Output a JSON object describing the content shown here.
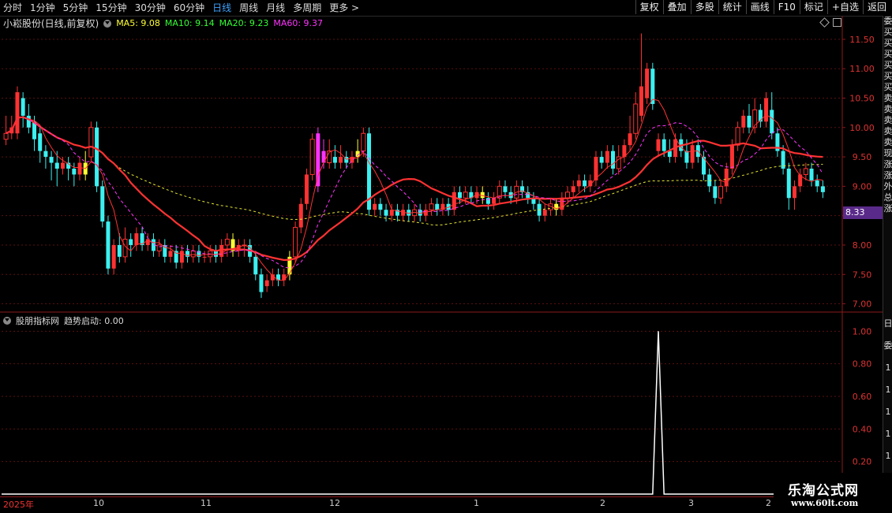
{
  "toolbar": {
    "periods": [
      "分时",
      "1分钟",
      "5分钟",
      "15分钟",
      "30分钟",
      "60分钟",
      "日线",
      "周线",
      "月线",
      "多周期",
      "更多 >"
    ],
    "active_period": "日线",
    "actions": [
      "复权",
      "叠加",
      "多股",
      "统计",
      "画线",
      "F10",
      "标记",
      "+自选",
      "返回"
    ]
  },
  "main": {
    "stock_title": "小崧股份(日线,前复权)",
    "ma": [
      {
        "label": "MA5: 9.08",
        "color": "#ffff33"
      },
      {
        "label": "MA10: 9.14",
        "color": "#33ff33"
      },
      {
        "label": "MA20: 9.23",
        "color": "#33ff33"
      },
      {
        "label": "MA60: 9.37",
        "color": "#ff33ff"
      }
    ],
    "price_axis": [
      "11.50",
      "11.00",
      "10.50",
      "10.00",
      "9.50",
      "9.00",
      "8.50",
      "8.00",
      "7.50",
      "7.00"
    ],
    "current_price": "8.33"
  },
  "indicator": {
    "title": "股朋指标网",
    "value_label": "趋势启动: 0.00",
    "axis": [
      "1.00",
      "0.80",
      "0.60",
      "0.40",
      "0.20"
    ]
  },
  "right_strip_chars": "委买买买买买买卖卖卖卖卖现涨涨外总涨",
  "right_strip_chars2": "日委11111",
  "date_axis": [
    "2025年",
    "10",
    "11",
    "12",
    "1",
    "2",
    "3",
    "2"
  ],
  "logo": {
    "line1": "乐淘公式网",
    "line2": "www.60lt.com"
  },
  "colors": {
    "up": "#ff3232",
    "down": "#3cf0f0",
    "limit_up": "#ff33ff",
    "yellow": "#ffff33"
  },
  "chart_data": {
    "type": "candlestick",
    "ylim": [
      6.9,
      11.7
    ],
    "price_ticks": [
      11.5,
      11.0,
      10.5,
      10.0,
      9.5,
      9.0,
      8.5,
      8.0,
      7.5,
      7.0
    ],
    "indicator_ylim": [
      0,
      1.05
    ],
    "indicator_ticks": [
      1.0,
      0.8,
      0.6,
      0.4,
      0.2
    ],
    "indicator_spike_index": 115,
    "candles": [
      [
        9.8,
        9.9,
        10.2,
        9.7
      ],
      [
        9.9,
        10.0,
        10.2,
        9.8
      ],
      [
        9.9,
        10.6,
        10.7,
        9.8
      ],
      [
        10.5,
        10.2,
        10.6,
        10.0
      ],
      [
        10.2,
        10.0,
        10.4,
        9.9
      ],
      [
        10.1,
        9.8,
        10.2,
        9.6
      ],
      [
        9.9,
        9.6,
        10.0,
        9.4
      ],
      [
        9.6,
        9.5,
        9.7,
        9.3
      ],
      [
        9.5,
        9.4,
        9.6,
        9.1
      ],
      [
        9.4,
        9.3,
        9.6,
        9.0
      ],
      [
        9.3,
        9.4,
        9.5,
        9.2
      ],
      [
        9.4,
        9.3,
        9.5,
        9.1
      ],
      [
        9.3,
        9.2,
        9.4,
        9.0
      ],
      [
        9.2,
        9.4,
        9.5,
        9.1
      ],
      [
        9.4,
        9.2,
        9.6,
        9.1
      ],
      [
        9.5,
        10.0,
        10.1,
        9.4
      ],
      [
        10.0,
        9.0,
        10.1,
        8.9
      ],
      [
        9.0,
        8.4,
        9.1,
        8.3
      ],
      [
        8.4,
        7.6,
        8.5,
        7.5
      ],
      [
        7.6,
        8.0,
        8.1,
        7.5
      ],
      [
        8.0,
        7.8,
        8.2,
        7.7
      ],
      [
        7.8,
        8.1,
        8.3,
        7.7
      ],
      [
        8.1,
        8.0,
        8.2,
        7.8
      ],
      [
        8.0,
        8.2,
        8.3,
        7.9
      ],
      [
        8.2,
        8.0,
        8.3,
        7.9
      ],
      [
        8.0,
        8.1,
        8.2,
        7.9
      ],
      [
        8.1,
        7.9,
        8.2,
        7.8
      ],
      [
        7.9,
        8.0,
        8.1,
        7.8
      ],
      [
        8.0,
        7.8,
        8.1,
        7.7
      ],
      [
        7.8,
        7.9,
        8.0,
        7.7
      ],
      [
        7.9,
        7.7,
        8.0,
        7.6
      ],
      [
        7.7,
        7.9,
        8.0,
        7.6
      ],
      [
        7.9,
        7.8,
        8.0,
        7.7
      ],
      [
        7.8,
        7.9,
        8.0,
        7.7
      ],
      [
        7.9,
        7.8,
        8.0,
        7.7
      ],
      [
        7.8,
        7.8,
        7.9,
        7.7
      ],
      [
        7.8,
        7.9,
        8.0,
        7.7
      ],
      [
        7.9,
        7.8,
        8.0,
        7.7
      ],
      [
        7.8,
        8.0,
        8.1,
        7.7
      ],
      [
        8.0,
        8.1,
        8.2,
        7.8
      ],
      [
        8.1,
        7.9,
        8.2,
        7.8
      ],
      [
        7.9,
        8.0,
        8.1,
        7.8
      ],
      [
        8.0,
        8.0,
        8.1,
        7.8
      ],
      [
        8.0,
        7.8,
        8.1,
        7.7
      ],
      [
        7.8,
        7.5,
        7.9,
        7.4
      ],
      [
        7.5,
        7.2,
        7.6,
        7.1
      ],
      [
        7.3,
        7.4,
        7.5,
        7.2
      ],
      [
        7.4,
        7.5,
        7.6,
        7.3
      ],
      [
        7.5,
        7.4,
        7.6,
        7.3
      ],
      [
        7.4,
        7.5,
        7.6,
        7.3
      ],
      [
        7.5,
        7.8,
        7.9,
        7.4
      ],
      [
        7.8,
        8.3,
        8.4,
        7.7
      ],
      [
        8.3,
        8.7,
        8.8,
        8.2
      ],
      [
        8.7,
        9.2,
        9.3,
        8.6
      ],
      [
        9.2,
        9.8,
        9.9,
        9.1
      ],
      [
        9.0,
        9.9,
        10.0,
        8.9
      ],
      [
        9.6,
        9.4,
        9.8,
        9.3
      ],
      [
        9.4,
        9.6,
        9.8,
        9.3
      ],
      [
        9.5,
        9.4,
        9.7,
        9.3
      ],
      [
        9.4,
        9.5,
        9.7,
        9.3
      ],
      [
        9.5,
        9.4,
        9.6,
        9.3
      ],
      [
        9.4,
        9.5,
        9.6,
        9.3
      ],
      [
        9.5,
        9.6,
        9.8,
        9.4
      ],
      [
        9.6,
        9.9,
        10.0,
        9.5
      ],
      [
        9.9,
        8.6,
        10.0,
        8.5
      ],
      [
        8.6,
        8.7,
        8.8,
        8.5
      ],
      [
        8.7,
        8.6,
        8.8,
        8.5
      ],
      [
        8.6,
        8.5,
        8.7,
        8.4
      ],
      [
        8.5,
        8.6,
        8.7,
        8.4
      ],
      [
        8.6,
        8.5,
        8.7,
        8.4
      ],
      [
        8.5,
        8.6,
        8.7,
        8.4
      ],
      [
        8.6,
        8.5,
        8.7,
        8.4
      ],
      [
        8.5,
        8.6,
        8.7,
        8.4
      ],
      [
        8.6,
        8.5,
        8.7,
        8.4
      ],
      [
        8.5,
        8.6,
        8.7,
        8.4
      ],
      [
        8.6,
        8.7,
        8.8,
        8.5
      ],
      [
        8.7,
        8.6,
        8.8,
        8.5
      ],
      [
        8.6,
        8.7,
        8.8,
        8.5
      ],
      [
        8.7,
        8.6,
        8.8,
        8.5
      ],
      [
        8.6,
        8.9,
        9.0,
        8.5
      ],
      [
        8.9,
        8.8,
        9.0,
        8.7
      ],
      [
        8.8,
        8.9,
        9.0,
        8.7
      ],
      [
        8.9,
        8.8,
        9.0,
        8.7
      ],
      [
        8.8,
        8.9,
        9.0,
        8.7
      ],
      [
        8.9,
        8.8,
        9.0,
        8.7
      ],
      [
        8.8,
        8.7,
        8.9,
        8.6
      ],
      [
        8.7,
        8.8,
        8.9,
        8.6
      ],
      [
        8.8,
        9.0,
        9.1,
        8.7
      ],
      [
        9.0,
        8.9,
        9.1,
        8.8
      ],
      [
        8.9,
        8.8,
        9.0,
        8.7
      ],
      [
        8.8,
        9.0,
        9.1,
        8.7
      ],
      [
        9.0,
        8.9,
        9.1,
        8.8
      ],
      [
        8.9,
        8.8,
        9.0,
        8.7
      ],
      [
        8.8,
        8.7,
        8.9,
        8.6
      ],
      [
        8.7,
        8.5,
        8.8,
        8.4
      ],
      [
        8.5,
        8.6,
        8.7,
        8.4
      ],
      [
        8.6,
        8.7,
        8.8,
        8.5
      ],
      [
        8.7,
        8.6,
        8.8,
        8.5
      ],
      [
        8.6,
        8.8,
        8.9,
        8.5
      ],
      [
        8.8,
        8.9,
        9.0,
        8.7
      ],
      [
        8.9,
        9.0,
        9.1,
        8.8
      ],
      [
        9.0,
        9.1,
        9.2,
        8.9
      ],
      [
        9.1,
        9.0,
        9.2,
        8.9
      ],
      [
        9.0,
        9.1,
        9.2,
        8.9
      ],
      [
        9.1,
        9.5,
        9.6,
        9.0
      ],
      [
        9.5,
        9.4,
        9.6,
        9.3
      ],
      [
        9.4,
        9.6,
        9.7,
        9.3
      ],
      [
        9.6,
        9.3,
        9.7,
        9.2
      ],
      [
        9.3,
        9.5,
        9.7,
        9.2
      ],
      [
        9.5,
        9.7,
        9.8,
        9.4
      ],
      [
        9.7,
        9.9,
        10.2,
        9.6
      ],
      [
        9.9,
        10.4,
        10.6,
        9.8
      ],
      [
        10.2,
        10.7,
        11.6,
        10.1
      ],
      [
        10.5,
        11.0,
        11.1,
        10.4
      ],
      [
        11.0,
        10.4,
        11.1,
        10.3
      ],
      [
        9.6,
        9.8,
        9.9,
        9.5
      ],
      [
        9.8,
        9.6,
        9.9,
        9.5
      ],
      [
        9.6,
        9.5,
        9.8,
        9.4
      ],
      [
        9.5,
        9.8,
        9.9,
        9.4
      ],
      [
        9.8,
        9.6,
        9.9,
        9.5
      ],
      [
        9.6,
        9.4,
        9.8,
        9.3
      ],
      [
        9.4,
        9.7,
        9.8,
        9.3
      ],
      [
        9.7,
        9.5,
        9.8,
        9.4
      ],
      [
        9.5,
        9.2,
        9.6,
        9.1
      ],
      [
        9.2,
        9.0,
        9.3,
        8.9
      ],
      [
        9.0,
        8.8,
        9.1,
        8.7
      ],
      [
        8.8,
        9.0,
        9.1,
        8.7
      ],
      [
        9.0,
        9.3,
        9.4,
        8.9
      ],
      [
        9.3,
        9.7,
        9.8,
        9.2
      ],
      [
        9.7,
        10.0,
        10.1,
        9.6
      ],
      [
        10.0,
        10.2,
        10.3,
        9.9
      ],
      [
        10.2,
        10.0,
        10.4,
        9.9
      ],
      [
        10.0,
        10.3,
        10.5,
        9.9
      ],
      [
        10.3,
        10.1,
        10.4,
        10.0
      ],
      [
        10.1,
        10.5,
        10.6,
        10.0
      ],
      [
        10.3,
        9.9,
        10.6,
        9.8
      ],
      [
        9.9,
        9.6,
        10.0,
        9.5
      ],
      [
        9.6,
        9.3,
        9.7,
        9.2
      ],
      [
        9.3,
        8.8,
        9.4,
        8.6
      ],
      [
        8.8,
        9.0,
        9.1,
        8.6
      ],
      [
        9.0,
        9.2,
        9.3,
        8.9
      ],
      [
        9.2,
        9.3,
        9.4,
        9.1
      ],
      [
        9.3,
        9.1,
        9.4,
        9.0
      ],
      [
        9.1,
        9.0,
        9.2,
        8.9
      ],
      [
        9.0,
        8.9,
        9.1,
        8.8
      ]
    ]
  }
}
